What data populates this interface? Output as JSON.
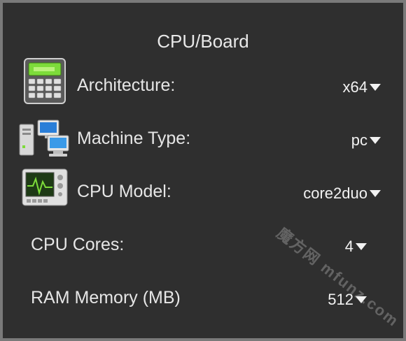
{
  "panel": {
    "title": "CPU/Board"
  },
  "rows": [
    {
      "label": "Architecture:",
      "value": "x64",
      "icon": "calculator-icon"
    },
    {
      "label": "Machine Type:",
      "value": "pc",
      "icon": "computers-icon"
    },
    {
      "label": "CPU Model:",
      "value": "core2duo",
      "icon": "monitor-icon"
    },
    {
      "label": "CPU Cores:",
      "value": "4"
    },
    {
      "label": "RAM Memory (MB)",
      "value": "512"
    }
  ],
  "watermark": {
    "text": "mfunz.com",
    "cn_text": "魔方网"
  },
  "colors": {
    "background": "#2f2f2f",
    "border": "#7a7a7a",
    "text": "#e6e6e6"
  }
}
